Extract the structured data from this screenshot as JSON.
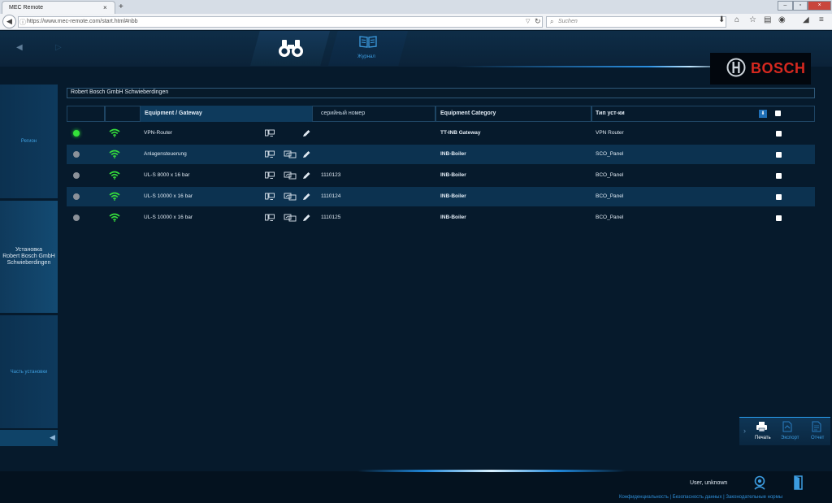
{
  "browser": {
    "tab_title": "MEC Remote",
    "tab_close": "×",
    "new_tab": "+",
    "url_host": "https://www.mec-remote.com",
    "url_path": "/start.html#nbb",
    "search_placeholder": "Suchen",
    "window_controls": [
      "–",
      "▫",
      "×"
    ]
  },
  "header": {
    "journal_label": "Журнал",
    "brand": "BOSCH"
  },
  "sidebar": {
    "items": [
      {
        "label": "Регион"
      },
      {
        "label": "Установка\nRobert Bosch GmbH\nSchwieberdingen"
      },
      {
        "label": "Часть установки"
      }
    ]
  },
  "table": {
    "breadcrumb": "Robert Bosch GmbH Schwieberdingen",
    "columns": {
      "equipment": "Equipment / Gateway",
      "serial": "серийный номер",
      "category": "Equipment Category",
      "type": "Тип уст-ки"
    },
    "rows": [
      {
        "status": "online",
        "name": "VPN-Router",
        "serial": "",
        "category": "TT-INB Gateway",
        "type": "VPN Router",
        "checked": false
      },
      {
        "status": "offline",
        "name": "Anlagensteuerung",
        "serial": "",
        "category": "INB-Boiler",
        "type": "SCO_Panel",
        "checked": false
      },
      {
        "status": "offline",
        "name": "UL-S 8000 x 16 bar",
        "serial": "1110123",
        "category": "INB-Boiler",
        "type": "BCO_Panel",
        "checked": false
      },
      {
        "status": "offline",
        "name": "UL-S 10000 x 16 bar",
        "serial": "1110124",
        "category": "INB-Boiler",
        "type": "BCO_Panel",
        "checked": false
      },
      {
        "status": "offline",
        "name": "UL-S 10000 x 16 bar",
        "serial": "1110125",
        "category": "INB-Boiler",
        "type": "BCO_Panel",
        "checked": false
      }
    ]
  },
  "toolbox": {
    "print_label": "Печать",
    "export_label": "Экспорт",
    "report_label": "Отчет"
  },
  "footer": {
    "user": "User, unknown",
    "links": "Конфиденциальность | Безопасность данных | Законодательные нормы"
  },
  "colors": {
    "accent": "#3c9ce0",
    "online": "#34e33a",
    "offline": "#8b9199",
    "brand_red": "#d6281f"
  }
}
